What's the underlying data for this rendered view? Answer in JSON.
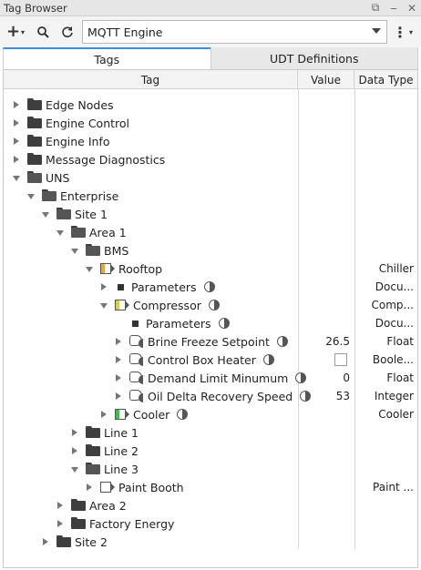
{
  "window": {
    "title": "Tag Browser",
    "controls": [
      "restore-icon",
      "minimize-icon",
      "close-icon"
    ]
  },
  "toolbar": {
    "add_icon": "plus-icon",
    "search_icon": "search-icon",
    "refresh_icon": "refresh-icon",
    "provider_value": "MQTT Engine",
    "menu_icon": "kebab-menu-icon"
  },
  "tabs": [
    {
      "label": "Tags",
      "active": true
    },
    {
      "label": "UDT Definitions",
      "active": false
    }
  ],
  "columns": {
    "tag": "Tag",
    "value": "Value",
    "datatype": "Data Type"
  },
  "colors": {
    "tab_accent": "#3c8dde",
    "rooftop_udt": "#f0a23b",
    "compressor_udt": "#d7d23a",
    "cooler_udt": "#3cc24a"
  },
  "rows": [
    {
      "depth": 0,
      "expand": "right",
      "icon": "folder",
      "label": "Edge Nodes",
      "value": "",
      "type": ""
    },
    {
      "depth": 0,
      "expand": "right",
      "icon": "folder",
      "label": "Engine Control",
      "value": "",
      "type": ""
    },
    {
      "depth": 0,
      "expand": "right",
      "icon": "folder",
      "label": "Engine Info",
      "value": "",
      "type": ""
    },
    {
      "depth": 0,
      "expand": "right",
      "icon": "folder",
      "label": "Message Diagnostics",
      "value": "",
      "type": ""
    },
    {
      "depth": 0,
      "expand": "down",
      "icon": "folder-open",
      "label": "UNS",
      "value": "",
      "type": ""
    },
    {
      "depth": 1,
      "expand": "down",
      "icon": "folder-open",
      "label": "Enterprise",
      "value": "",
      "type": ""
    },
    {
      "depth": 2,
      "expand": "down",
      "icon": "folder-open",
      "label": "Site 1",
      "value": "",
      "type": ""
    },
    {
      "depth": 3,
      "expand": "down",
      "icon": "folder-open",
      "label": "Area 1",
      "value": "",
      "type": ""
    },
    {
      "depth": 4,
      "expand": "down",
      "icon": "folder-open",
      "label": "BMS",
      "value": "",
      "type": ""
    },
    {
      "depth": 5,
      "expand": "down",
      "icon": "udt",
      "udt_color": "#f0a23b",
      "label": "Rooftop",
      "value": "",
      "type": "Chiller"
    },
    {
      "depth": 6,
      "expand": "right",
      "icon": "square",
      "label": "Parameters",
      "overlay": true,
      "value": "",
      "type": "Docu..."
    },
    {
      "depth": 6,
      "expand": "down",
      "icon": "udt",
      "udt_color": "#d7d23a",
      "label": "Compressor",
      "overlay": true,
      "value": "",
      "type": "Comp..."
    },
    {
      "depth": 7,
      "expand": "",
      "icon": "square",
      "label": "Parameters",
      "overlay": true,
      "value": "",
      "type": "Docu..."
    },
    {
      "depth": 7,
      "expand": "right",
      "icon": "tag",
      "label": "Brine Freeze Setpoint",
      "overlay": true,
      "value": "26.5",
      "type": "Float"
    },
    {
      "depth": 7,
      "expand": "right",
      "icon": "tag",
      "label": "Control Box Heater",
      "overlay": true,
      "value": "",
      "checkbox": true,
      "type": "Boole..."
    },
    {
      "depth": 7,
      "expand": "right",
      "icon": "tag",
      "label": "Demand Limit Minumum",
      "overlay": true,
      "value": "0",
      "type": "Float"
    },
    {
      "depth": 7,
      "expand": "right",
      "icon": "tag",
      "label": "Oil Delta Recovery Speed",
      "overlay": true,
      "value": "53",
      "type": "Integer"
    },
    {
      "depth": 6,
      "expand": "right",
      "icon": "udt",
      "udt_color": "#3cc24a",
      "label": "Cooler",
      "overlay": true,
      "value": "",
      "type": "Cooler"
    },
    {
      "depth": 4,
      "expand": "right",
      "icon": "folder",
      "label": "Line 1",
      "value": "",
      "type": ""
    },
    {
      "depth": 4,
      "expand": "right",
      "icon": "folder",
      "label": "Line 2",
      "value": "",
      "type": ""
    },
    {
      "depth": 4,
      "expand": "down",
      "icon": "folder-open",
      "label": "Line 3",
      "value": "",
      "type": ""
    },
    {
      "depth": 5,
      "expand": "right",
      "icon": "udt-empty",
      "label": "Paint Booth",
      "value": "",
      "type": "Paint ..."
    },
    {
      "depth": 3,
      "expand": "right",
      "icon": "folder",
      "label": "Area 2",
      "value": "",
      "type": ""
    },
    {
      "depth": 3,
      "expand": "right",
      "icon": "folder",
      "label": "Factory Energy",
      "value": "",
      "type": ""
    },
    {
      "depth": 2,
      "expand": "right",
      "icon": "folder",
      "label": "Site 2",
      "value": "",
      "type": ""
    }
  ]
}
